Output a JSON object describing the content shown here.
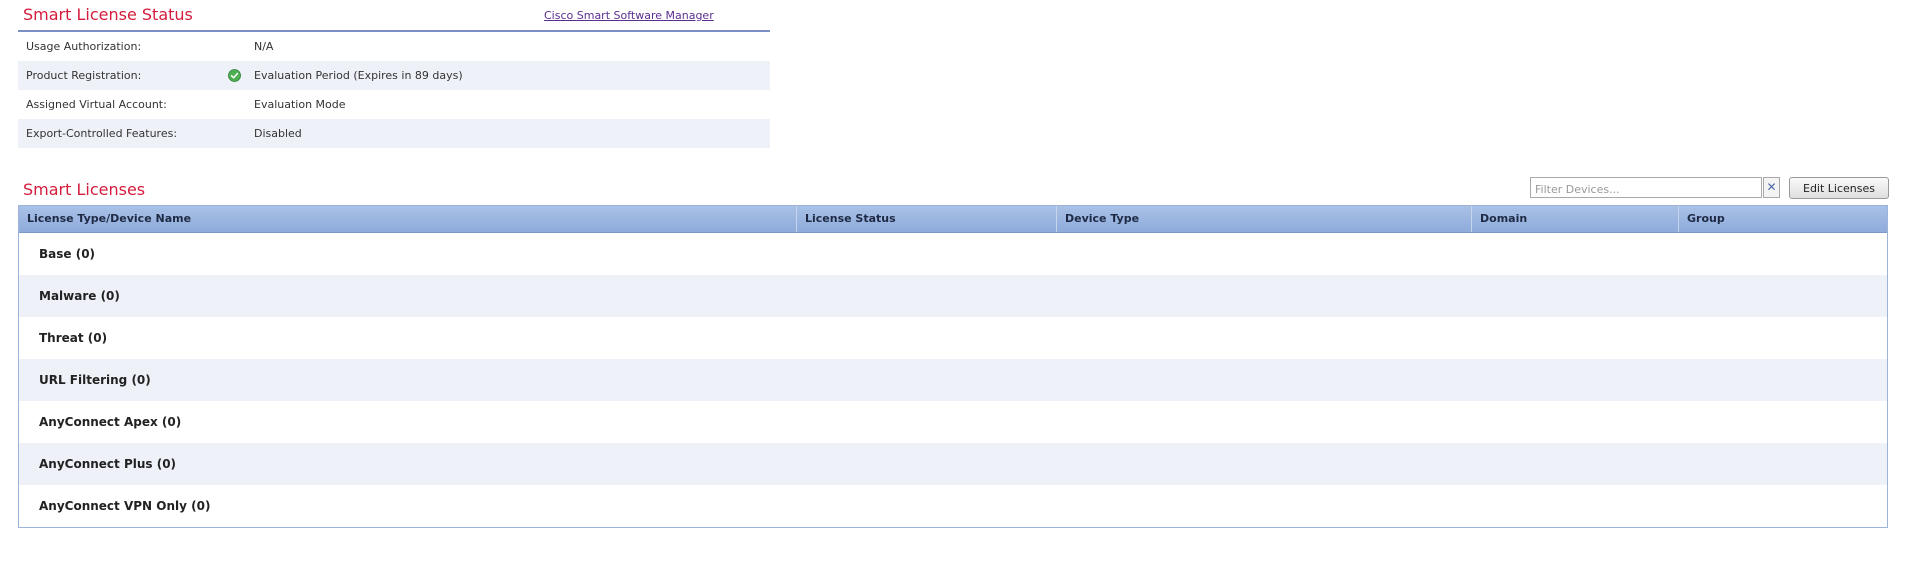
{
  "status": {
    "title": "Smart License Status",
    "link_label": "Cisco Smart Software Manager",
    "rows": [
      {
        "label": "Usage Authorization:",
        "value": "N/A"
      },
      {
        "label": "Product Registration:",
        "value": "Evaluation Period (Expires in 89 days)",
        "icon": "check-circle-icon"
      },
      {
        "label": "Assigned Virtual Account:",
        "value": "Evaluation Mode"
      },
      {
        "label": "Export-Controlled Features:",
        "value": "Disabled"
      }
    ]
  },
  "licenses": {
    "title": "Smart Licenses",
    "filter_placeholder": "Filter Devices...",
    "clear_label": "✕",
    "edit_button": "Edit Licenses",
    "columns": [
      "License Type/Device Name",
      "License Status",
      "Device Type",
      "Domain",
      "Group"
    ],
    "rows": [
      "Base (0)",
      "Malware (0)",
      "Threat (0)",
      "URL Filtering (0)",
      "AnyConnect Apex (0)",
      "AnyConnect Plus (0)",
      "AnyConnect VPN Only (0)"
    ]
  },
  "colors": {
    "title_red": "#d41c3c",
    "header_blue": "#8eabdb",
    "row_alt": "#eef2f8",
    "ok_green": "#4caf50"
  }
}
